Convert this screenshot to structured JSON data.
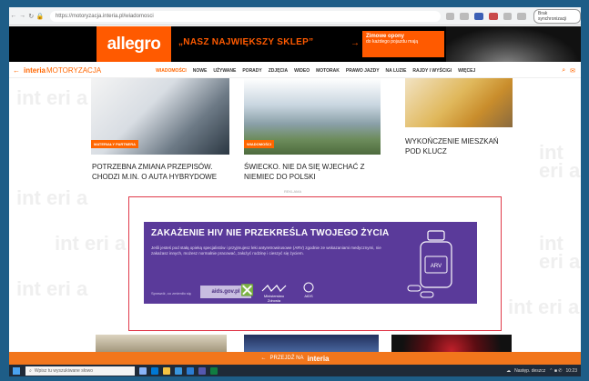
{
  "browser": {
    "url": "https://motoryzacja.interia.pl/wiadomosci",
    "sync_label": "Brak synchronizacji"
  },
  "banner": {
    "logo": "allegro",
    "slogan": "„NASZ NAJWIĘKSZY SKLEP”",
    "arrow": "→",
    "promo_title": "Zimowe opony",
    "promo_text": "do każdego pojazdu mają"
  },
  "nav": {
    "back": "←",
    "brand": "interia",
    "section": "MOTORYZACJA",
    "items": [
      "WIADOMOŚCI",
      "NOWE",
      "UŻYWANE",
      "PORADY",
      "ZDJĘCIA",
      "WIDEO",
      "MOTORAK",
      "PRAWO JAZDY",
      "NA LUZIE",
      "RAJDY I WYŚCIGI",
      "WIĘCEJ"
    ],
    "search_icon": "⌕",
    "mail_icon": "✉"
  },
  "watermark": {
    "text": "int eri a"
  },
  "articles": [
    {
      "tag": "MATERIAŁY PARTNERA",
      "title": "POTRZEBNA ZMIANA PRZEPISÓW. CHODZI M.IN. O AUTA HYBRYDOWE"
    },
    {
      "tag": "WIADOMOŚCI",
      "title": "ŚWIECKO. NIE DA SIĘ WJECHAĆ Z NIEMIEC DO POLSKI"
    },
    {
      "tag": "",
      "title": "WYKOŃCZENIE MIESZKAŃ POD KLUCZ"
    }
  ],
  "ad": {
    "label": "REKLAMA",
    "headline": "ZAKAŻENIE HIV NIE PRZEKREŚLA TWOJEGO ŻYCIA",
    "body": "Jeśli jesteś pod stałą opieką specjalistów i przyjmujesz leki antyretrowirusowe (ARV) zgodnie ze wskazaniami medycznymi, nie zakażasz innych, możesz normalnie pracować, założyć rodzinę i cieszyć się życiem.",
    "check_label": "Sprawdź, co zmieniło się",
    "cta": "aids.gov.pl",
    "logo1": "Ministerstwo Zdrowia",
    "logo2": "AIDS",
    "bottle_label": "ARV"
  },
  "bottom_bar": {
    "arrow": "←",
    "text": "PRZEJDŹ NA",
    "brand": "interia"
  },
  "taskbar": {
    "search_placeholder": "Wpisz tu wyszukiwane słowo",
    "weather": "Następ. deszcz",
    "time": "10:23"
  }
}
